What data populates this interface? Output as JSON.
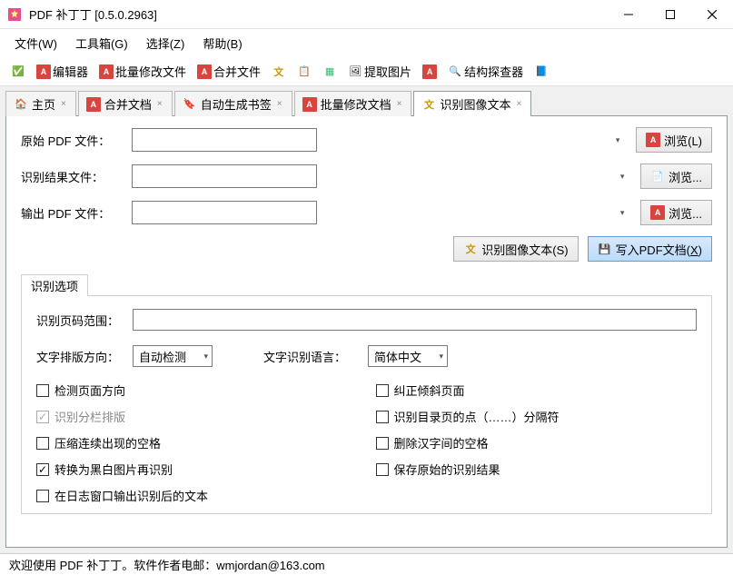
{
  "window": {
    "title": "PDF 补丁丁 [0.5.0.2963]"
  },
  "menubar": {
    "file": "文件(W)",
    "toolbox": "工具箱(G)",
    "select": "选择(Z)",
    "help": "帮助(B)"
  },
  "toolbar": {
    "editor": "编辑器",
    "batchModify": "批量修改文件",
    "merge": "合并文件",
    "extractImages": "提取图片",
    "structureInspector": "结构探查器"
  },
  "tabs": {
    "home": "主页",
    "mergeDoc": "合并文档",
    "autoBookmark": "自动生成书签",
    "batchModify": "批量修改文档",
    "ocrImage": "识别图像文本"
  },
  "form": {
    "srcLabel": "原始 PDF 文件：",
    "resultLabel": "识别结果文件：",
    "outLabel": "输出 PDF 文件：",
    "browse1": "浏览(L)",
    "browse2": "浏览...",
    "browse3": "浏览...",
    "ocrBtn": "识别图像文本(S)",
    "writeBtn_prefix": "写入PDF文档(",
    "writeBtn_key": "X",
    "writeBtn_suffix": ")"
  },
  "options": {
    "groupTitle": "识别选项",
    "pageRangeLabel": "识别页码范围：",
    "layoutLabel": "文字排版方向：",
    "layoutValue": "自动检测",
    "langLabel": "文字识别语言：",
    "langValue": "简体中文",
    "detectOrientation": "检测页面方向",
    "correctTilt": "纠正倾斜页面",
    "ocrColumns": "识别分栏排版",
    "tocDots": "识别目录页的点（……）分隔符",
    "compressSpaces": "压缩连续出现的空格",
    "removeHanziSpaces": "删除汉字间的空格",
    "convertBW": "转换为黑白图片再识别",
    "keepOriginal": "保存原始的识别结果",
    "logOutput": "在日志窗口输出识别后的文本"
  },
  "status": {
    "text": "欢迎使用 PDF 补丁丁。软件作者电邮：wmjordan@163.com"
  }
}
